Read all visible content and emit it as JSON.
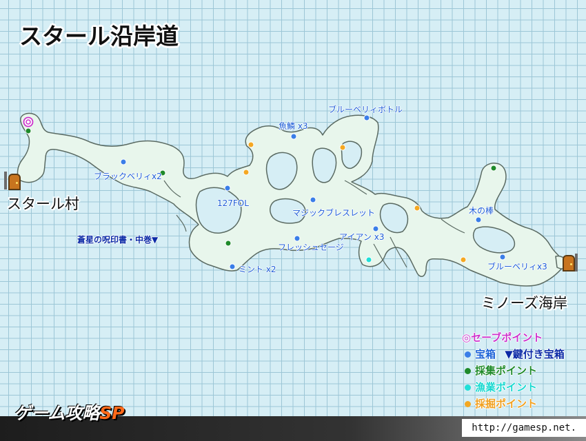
{
  "title": "スタール沿岸道",
  "places": {
    "west_village": "スタール村",
    "east_coast": "ミノーズ海岸"
  },
  "markers": [
    {
      "label": "ブルーベリィボトル",
      "type": "treasure"
    },
    {
      "label": "魚鱗 x3",
      "type": "treasure"
    },
    {
      "label": "ブラックベリィx2",
      "type": "treasure"
    },
    {
      "label": "127FOL",
      "type": "treasure"
    },
    {
      "label": "マジックブレスレット",
      "type": "treasure"
    },
    {
      "label": "木の棒",
      "type": "treasure"
    },
    {
      "label": "アイアン x3",
      "type": "treasure"
    },
    {
      "label": "フレッシュセージ",
      "type": "treasure"
    },
    {
      "label": "ブルーベリィx3",
      "type": "treasure"
    },
    {
      "label": "ミント x2",
      "type": "treasure"
    },
    {
      "label": "蒼星の呪印書・中巻▼",
      "type": "locked-treasure"
    }
  ],
  "legend": [
    {
      "symbol": "◎",
      "label": "セーブポイント",
      "color": "#cc33cc"
    },
    {
      "symbol": "●",
      "label": "宝箱",
      "color": "#1e64d8",
      "extra": "▼鍵付き宝箱"
    },
    {
      "symbol": "●",
      "label": "採集ポイント",
      "color": "#1e8a2a"
    },
    {
      "symbol": "●",
      "label": "漁業ポイント",
      "color": "#18d8d0"
    },
    {
      "symbol": "●",
      "label": "採掘ポイント",
      "color": "#f0a020"
    }
  ],
  "colors": {
    "treasure": "#3a7ee8",
    "gather": "#1e8a2a",
    "fishing": "#20e0d8",
    "mining": "#f4a822",
    "save": "#cc33cc",
    "land": "#e8f6ec",
    "outline": "#5a6a62"
  },
  "footer": {
    "brand_main": "ゲーム攻略",
    "brand_sp": "SP",
    "url": "http://gamesp.net."
  }
}
